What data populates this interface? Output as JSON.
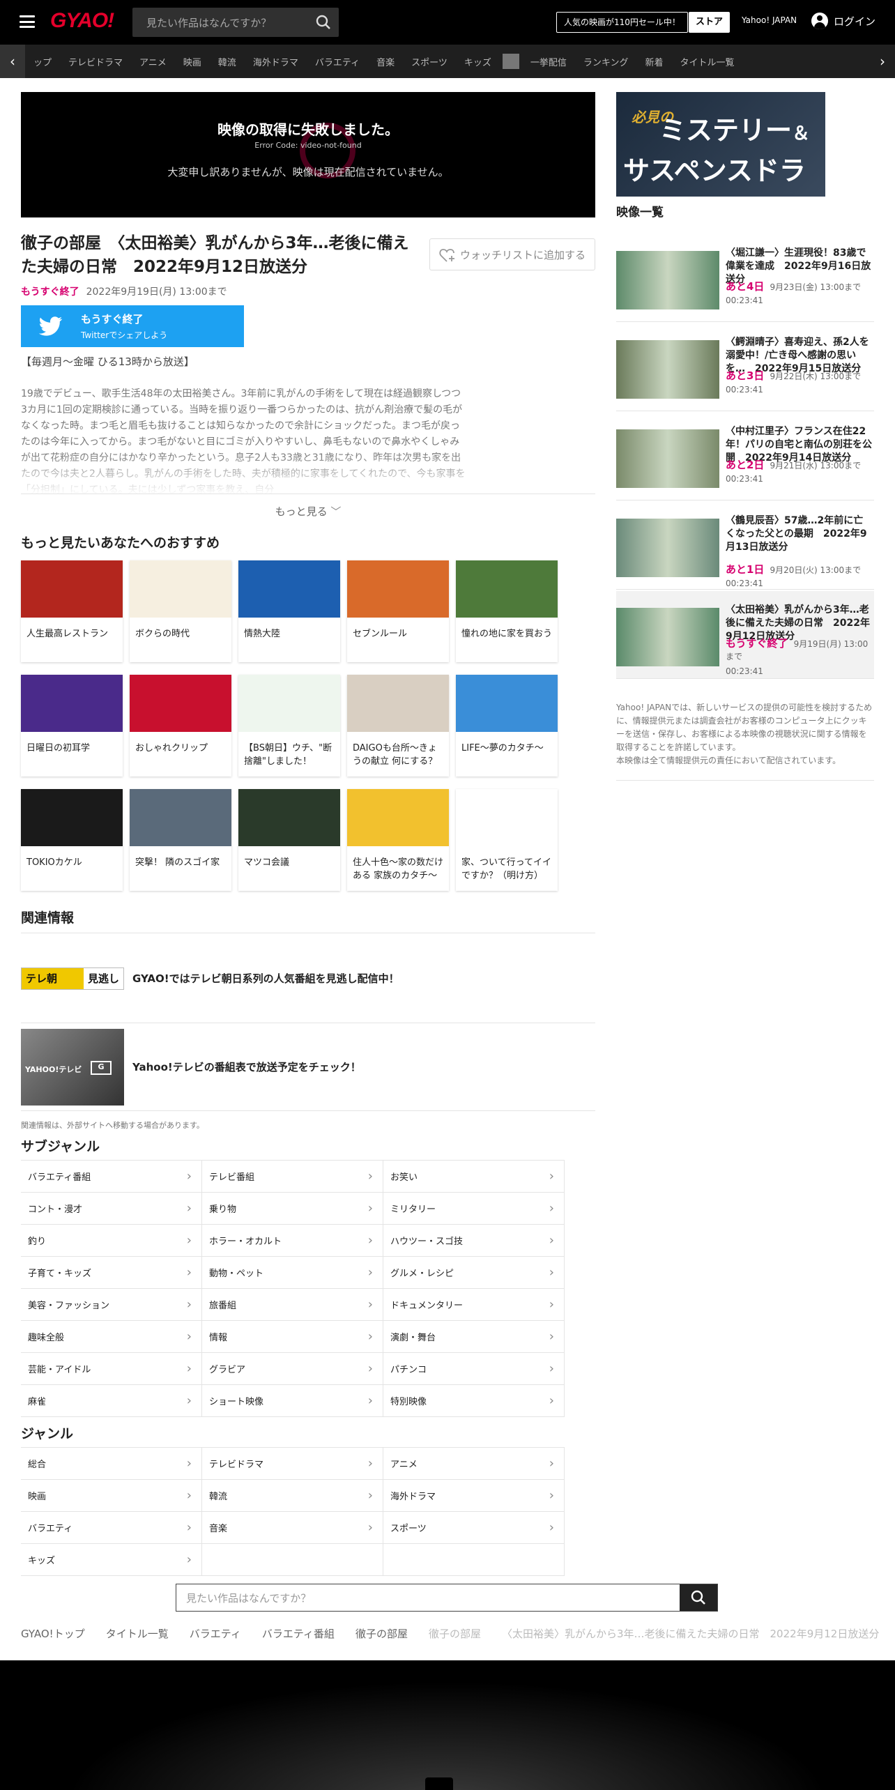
{
  "header": {
    "logo": "GYAO!",
    "search_placeholder": "見たい作品はなんですか？",
    "promo": "人気の映画が110円セール中！",
    "store": "ストア",
    "yahoo": "Yahoo! JAPAN",
    "login": "ログイン"
  },
  "nav": {
    "items": [
      "ップ",
      "テレビドラマ",
      "アニメ",
      "映画",
      "韓流",
      "海外ドラマ",
      "バラエティ",
      "音楽",
      "スポーツ",
      "キッズ"
    ],
    "items2": [
      "一挙配信",
      "ランキング",
      "新着",
      "タイトル一覧"
    ]
  },
  "player": {
    "error_title": "映像の取得に失敗しました。",
    "error_code": "Error Code: video-not-found",
    "error_message": "大変申し訳ありませんが、映像は現在配信されていません。"
  },
  "program": {
    "title": "徹子の部屋　〈太田裕美〉乳がんから3年…老後に備えた夫婦の日常　2022年9月12日放送分",
    "watchlist": "ウォッチリストに追加する",
    "status": "もうすぐ終了",
    "until": "2022年9月19日(月) 13:00まで",
    "twitter_label": "もうすぐ終了",
    "twitter_share": "Twitterでシェアしよう",
    "slot": "【毎週月～金曜 ひる13時から放送】",
    "description": "19歳でデビュー、歌手生活48年の太田裕美さん。3年前に乳がんの手術をして現在は経過観察しつつ3カ月に1回の定期検診に通っている。当時を振り返り一番つらかったのは、抗がん剤治療で髪の毛がなくなった時。まつ毛と眉毛も抜けることは知らなかったので余計にショックだった。まつ毛が戻ったのは今年に入ってから。まつ毛がないと目にゴミが入りやすいし、鼻毛もないので鼻水やくしゃみが出て花粉症の自分にはかなり辛かったという。息子2人も33歳と31歳になり、昨年は次男も家を出たので今は夫と2人暮らし。乳がんの手術をした時、夫が積極的に家事をしてくれたので、今も家事を「分担制」にしている。夫には少しずつ家事を教え、自分",
    "more": "もっと見る"
  },
  "recommend": {
    "heading": "もっと見たいあなたへのおすすめ",
    "items": [
      {
        "label": "人生最高レストラン",
        "color": "#b3261e"
      },
      {
        "label": "ボクらの時代",
        "color": "#f6efe0"
      },
      {
        "label": "情熱大陸",
        "color": "#1d5fb0"
      },
      {
        "label": "セブンルール",
        "color": "#d96a2a"
      },
      {
        "label": "憧れの地に家を買おう",
        "color": "#4e7a3a"
      },
      {
        "label": "日曜日の初耳学",
        "color": "#4a2a8a"
      },
      {
        "label": "おしゃれクリップ",
        "color": "#c8102e"
      },
      {
        "label": "【BS朝日】ウチ、\"断捨離\"しました！",
        "color": "#eef6ee"
      },
      {
        "label": "DAIGOも台所～きょうの献立 何にする？",
        "color": "#d9cfc2"
      },
      {
        "label": "LIFE～夢のカタチ～",
        "color": "#3a8ed8"
      },
      {
        "label": "TOKIOカケル",
        "color": "#1a1a1a"
      },
      {
        "label": "突撃！ 隣のスゴイ家",
        "color": "#5a6a7a"
      },
      {
        "label": "マツコ会議",
        "color": "#2a3a2a"
      },
      {
        "label": "住人十色～家の数だけある 家族のカタチ～",
        "color": "#f2c12e"
      },
      {
        "label": "家、ついて行ってイイですか？（明け方）",
        "color": "#ffffff"
      }
    ]
  },
  "related": {
    "heading": "関連情報",
    "items": [
      {
        "logo": "テレ朝",
        "logo2": "見逃し",
        "label": "GYAO!ではテレビ朝日系列の人気番組を見逃し配信中！"
      },
      {
        "logo": "YAHOO!テレビ",
        "logo2": "G",
        "label": "Yahoo!テレビの番組表で放送予定をチェック！"
      }
    ],
    "note": "関連情報は、外部サイトへ移動する場合があります。"
  },
  "subgenre": {
    "heading": "サブジャンル",
    "items": [
      "バラエティ番組",
      "テレビ番組",
      "お笑い",
      "コント・漫才",
      "乗り物",
      "ミリタリー",
      "釣り",
      "ホラー・オカルト",
      "ハウツー・スゴ技",
      "子育て・キッズ",
      "動物・ペット",
      "グルメ・レシピ",
      "美容・ファッション",
      "旅番組",
      "ドキュメンタリー",
      "趣味全般",
      "情報",
      "演劇・舞台",
      "芸能・アイドル",
      "グラビア",
      "パチンコ",
      "麻雀",
      "ショート映像",
      "特別映像"
    ]
  },
  "genre": {
    "heading": "ジャンル",
    "items": [
      "総合",
      "テレビドラマ",
      "アニメ",
      "映画",
      "韓流",
      "海外ドラマ",
      "バラエティ",
      "音楽",
      "スポーツ",
      "キッズ"
    ]
  },
  "bottom_search": {
    "placeholder": "見たい作品はなんですか？"
  },
  "breadcrumb": [
    "GYAO!トップ",
    "タイトル一覧",
    "バラエティ",
    "バラエティ番組",
    "徹子の部屋"
  ],
  "breadcrumb_current": [
    "徹子の部屋",
    "〈太田裕美〉乳がんから3年…老後に備えた夫婦の日常　2022年9月12日放送分"
  ],
  "sidebar": {
    "banner": {
      "b1": "必見の",
      "b2": "ミステリー",
      "amp": "＆",
      "b3": "サスペンスドラマ"
    },
    "heading": "映像一覧",
    "videos": [
      {
        "title": "〈堀江謙一〉生涯現役！83歳で偉業を達成　2022年9月16日放送分",
        "remain": "あと4日",
        "date": "9月23日(金) 13:00まで",
        "duration": "00:23:41"
      },
      {
        "title": "〈鰐淵晴子〉喜寿迎え、孫2人を溺愛中！/亡き母へ感謝の思いを…　2022年9月15日放送分",
        "remain": "あと3日",
        "date": "9月22日(木) 13:00まで",
        "duration": "00:23:41"
      },
      {
        "title": "〈中村江里子〉フランス在住22年！パリの自宅と南仏の別荘を公開　2022年9月14日放送分",
        "remain": "あと2日",
        "date": "9月21日(水) 13:00まで",
        "duration": "00:23:41"
      },
      {
        "title": "〈鶴見辰吾〉57歳…2年前に亡くなった父との最期　2022年9月13日放送分",
        "remain": "あと1日",
        "date": "9月20日(火) 13:00まで",
        "duration": "00:23:41"
      },
      {
        "title": "〈太田裕美〉乳がんから3年…老後に備えた夫婦の日常　2022年9月12日放送分",
        "remain": "もうすぐ終了",
        "date": "9月19日(月) 13:00まで",
        "duration": "00:23:41"
      }
    ],
    "note": "Yahoo! JAPANでは、新しいサービスの提供の可能性を検討するために、情報提供元または調査会社がお客様のコンピュータ上にクッキーを送信・保存し、お客様による本映像の視聴状況に関する情報を取得することを許諾しています。\n本映像は全て情報提供元の責任において配信されています。"
  },
  "colors": {
    "brand": "#e4002b",
    "accent": "#d6006f",
    "twitter": "#1da1f2"
  }
}
